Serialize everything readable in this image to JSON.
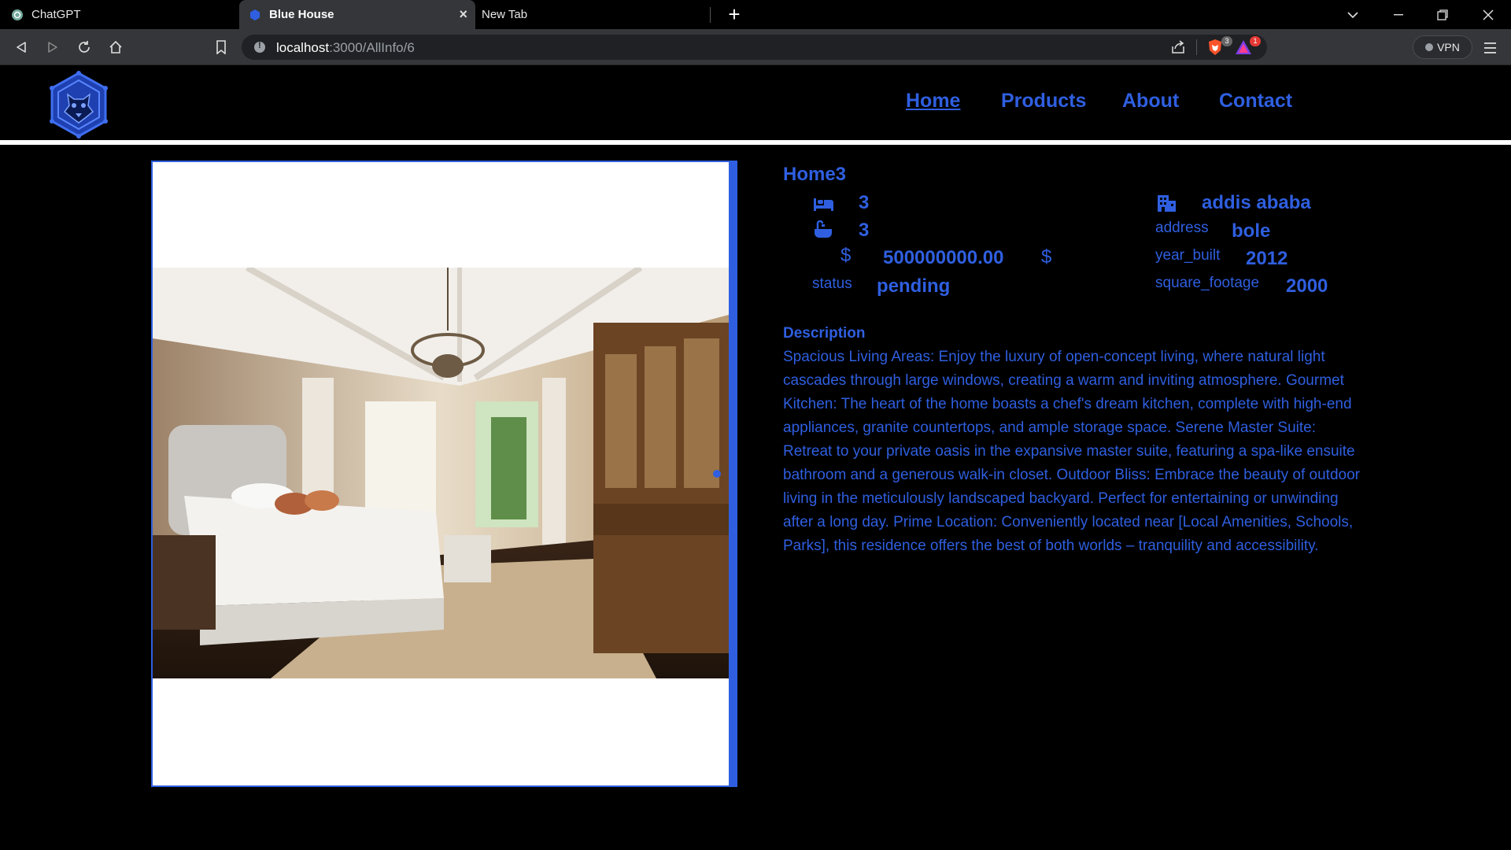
{
  "browser": {
    "tabs": [
      {
        "title": "ChatGPT",
        "icon": "chatgpt-icon"
      },
      {
        "title": "Blue House",
        "icon": "site-logo-icon"
      },
      {
        "title": "New Tab",
        "icon": ""
      }
    ],
    "url_host": "localhost",
    "url_path": ":3000/AllInfo/6",
    "shield_count": "3",
    "rewards_count": "1",
    "vpn_label": "VPN"
  },
  "nav": {
    "home": "Home",
    "products": "Products",
    "about": "About",
    "contact": "Contact"
  },
  "property": {
    "title": "Home3",
    "bedrooms": "3",
    "bathrooms": "3",
    "currency_left": "$",
    "price": "500000000.00",
    "currency_right": "$",
    "status_label": "status",
    "status": "pending",
    "city": "addis ababa",
    "address_label": "address",
    "address": "bole",
    "year_built_label": "year_built",
    "year_built": "2012",
    "square_footage_label": "square_footage",
    "square_footage": "2000"
  },
  "description": {
    "heading": "Description",
    "text": "Spacious Living Areas: Enjoy the luxury of open-concept living, where natural light cascades through large windows, creating a warm and inviting atmosphere. Gourmet Kitchen: The heart of the home boasts a chef's dream kitchen, complete with high-end appliances, granite countertops, and ample storage space. Serene Master Suite: Retreat to your private oasis in the expansive master suite, featuring a spa-like ensuite bathroom and a generous walk-in closet. Outdoor Bliss: Embrace the beauty of outdoor living in the meticulously landscaped backyard. Perfect for entertaining or unwinding after a long day. Prime Location: Conveniently located near [Local Amenities, Schools, Parks], this residence offers the best of both worlds – tranquility and accessibility."
  },
  "colors": {
    "accent": "#2f5fe0",
    "background": "#000000",
    "chrome": "#35363a"
  }
}
